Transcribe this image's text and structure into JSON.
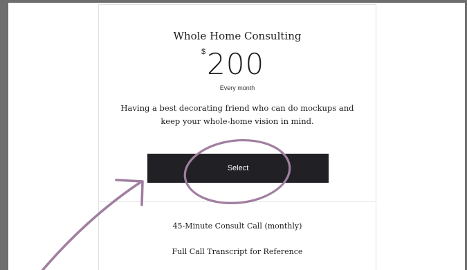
{
  "plan": {
    "title": "Whole Home Consulting",
    "currency": "$",
    "price": "200",
    "period": "Every month",
    "description": "Having a best decorating friend who can do mockups and keep your whole-home vision in mind.",
    "select_label": "Select"
  },
  "features": [
    "45-Minute Consult Call (monthly)",
    "Full Call Transcript for Reference"
  ],
  "annotation": {
    "color": "#a07fa0"
  }
}
